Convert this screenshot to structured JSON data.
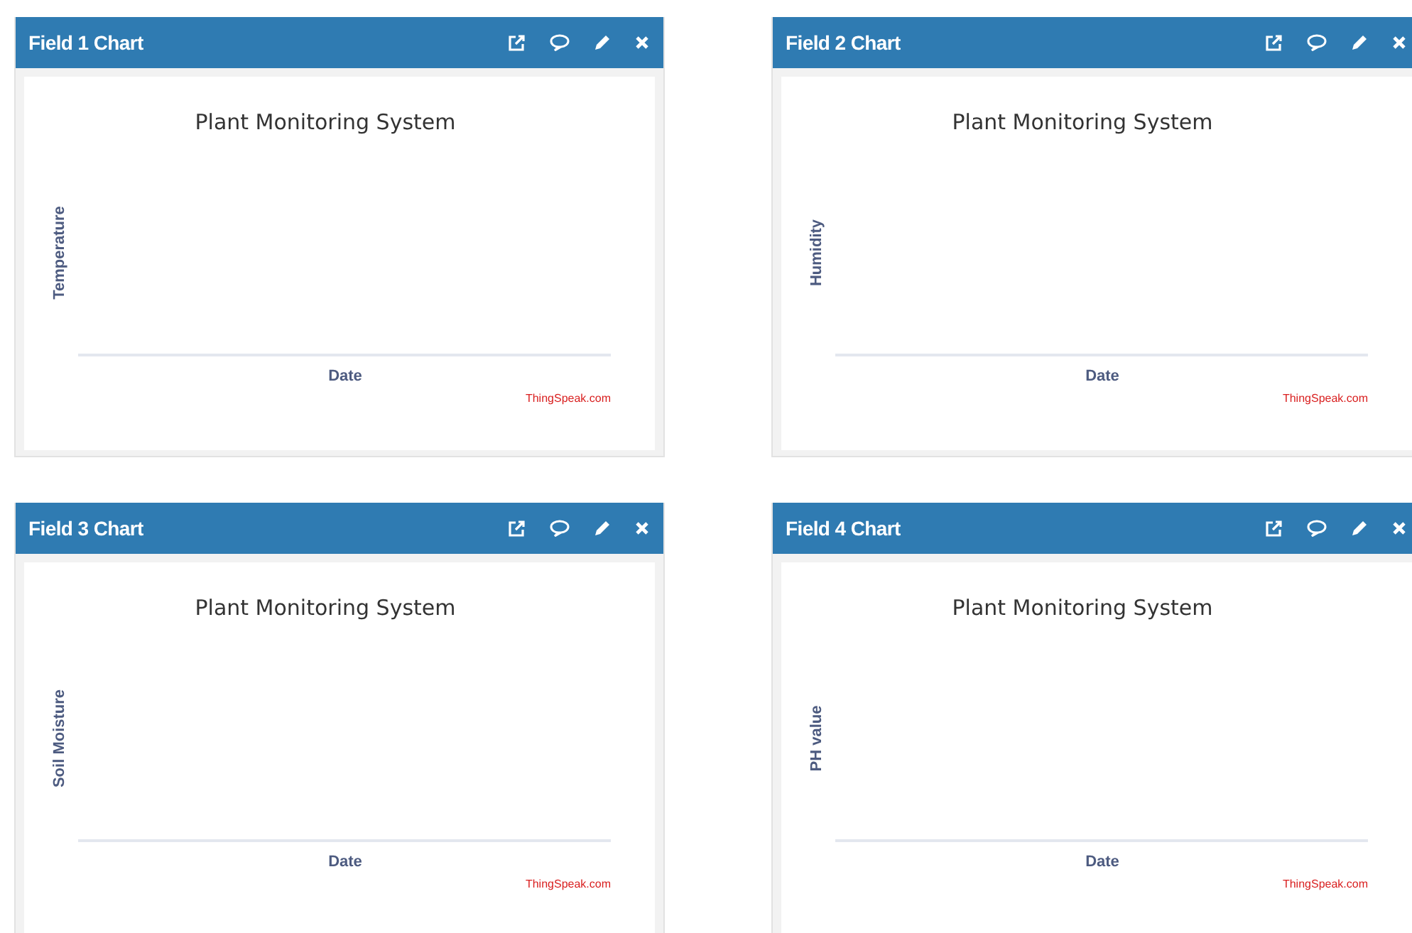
{
  "cards": [
    {
      "title": "Field 1 Chart",
      "chart_title": "Plant Monitoring System",
      "ylabel": "Temperature",
      "xlabel": "Date",
      "credit": "ThingSpeak.com"
    },
    {
      "title": "Field 2 Chart",
      "chart_title": "Plant Monitoring System",
      "ylabel": "Humidity",
      "xlabel": "Date",
      "credit": "ThingSpeak.com"
    },
    {
      "title": "Field 3 Chart",
      "chart_title": "Plant Monitoring System",
      "ylabel": "Soil Moisture",
      "xlabel": "Date",
      "credit": "ThingSpeak.com"
    },
    {
      "title": "Field 4 Chart",
      "chart_title": "Plant Monitoring System",
      "ylabel": "PH value",
      "xlabel": "Date",
      "credit": "ThingSpeak.com"
    }
  ]
}
